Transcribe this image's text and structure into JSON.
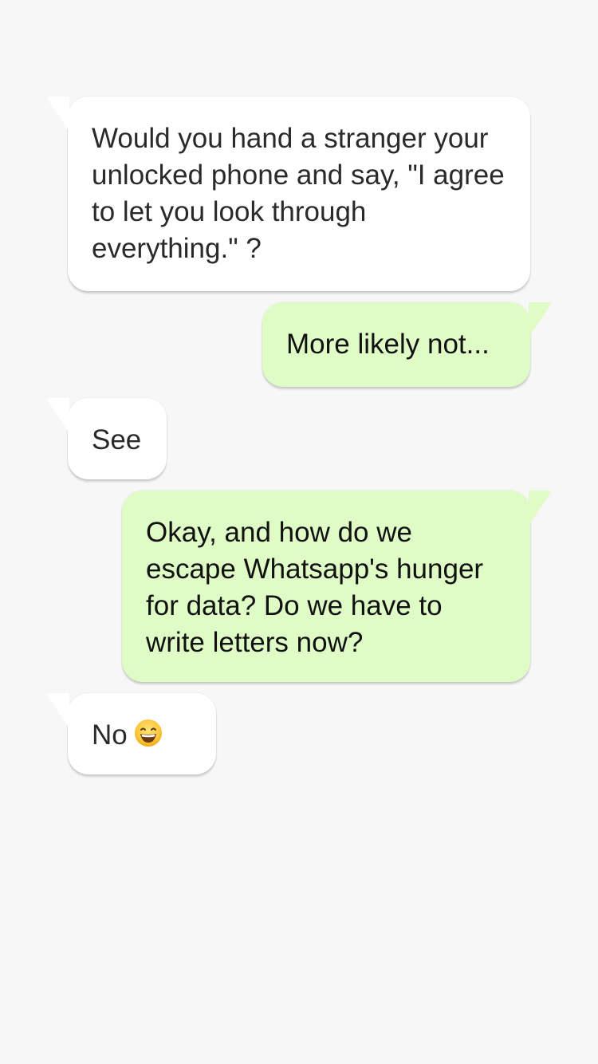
{
  "conversation": {
    "messages": [
      {
        "direction": "incoming",
        "text": "Would you hand a stranger your unlocked phone and say, \"I agree to let you look through everything.\" ?"
      },
      {
        "direction": "outgoing",
        "text": "More likely not..."
      },
      {
        "direction": "incoming",
        "text": "See"
      },
      {
        "direction": "outgoing",
        "text": "Okay, and how do we escape Whatsapp's hunger for data? Do we have to write letters now?"
      },
      {
        "direction": "incoming",
        "text": "No",
        "emoji": "grinning-face-with-smiling-eyes-emoji"
      }
    ]
  },
  "colors": {
    "background": "#f7f7f7",
    "incoming_bubble": "#ffffff",
    "outgoing_bubble": "#e0fcc6"
  }
}
